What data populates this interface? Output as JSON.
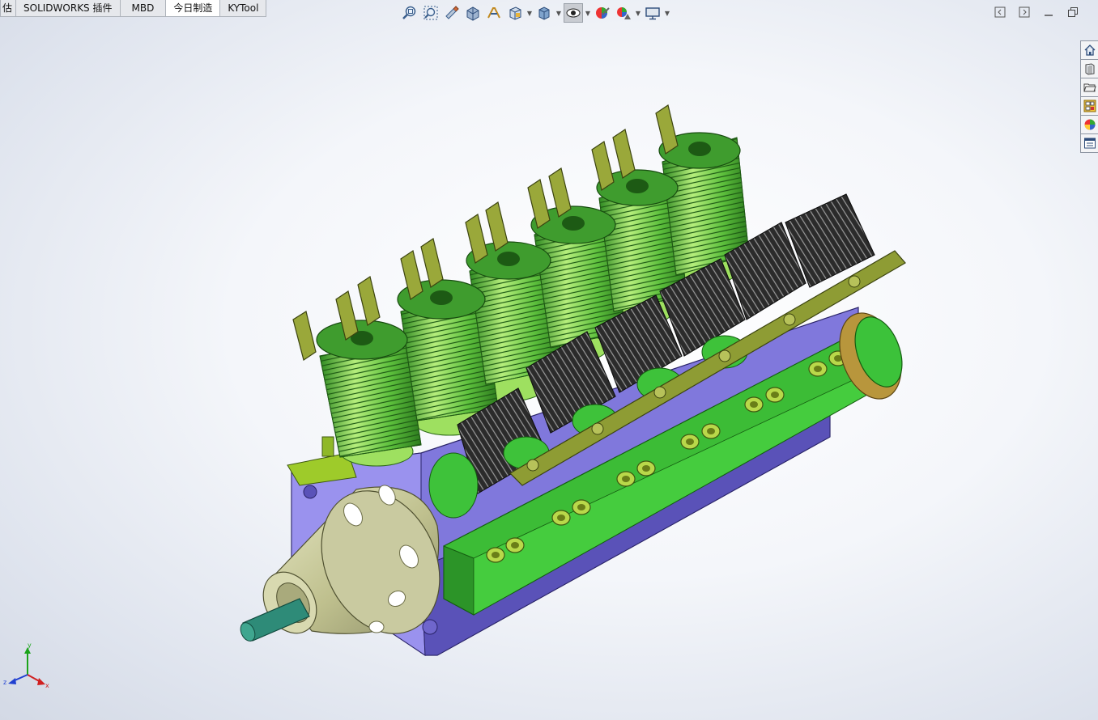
{
  "tabs": [
    {
      "label": "估",
      "active": false
    },
    {
      "label": "SOLIDWORKS 插件",
      "active": false
    },
    {
      "label": "MBD",
      "active": false
    },
    {
      "label": "今日制造",
      "active": true
    },
    {
      "label": "KYTool",
      "active": false
    }
  ],
  "toolbar": {
    "buttons": [
      "zoom-to-fit-icon",
      "zoom-to-area-icon",
      "previous-view-icon",
      "section-view-icon",
      "dynamic-annotation-icon",
      "view-orientation-icon",
      "display-style-icon",
      "hide-show-items-icon",
      "edit-appearance-icon",
      "apply-scene-icon",
      "view-settings-icon"
    ]
  },
  "window_controls": [
    "collapse-left-icon",
    "collapse-right-icon",
    "minimize-icon",
    "restore-icon"
  ],
  "task_pane": [
    "home-icon",
    "design-library-icon",
    "file-explorer-icon",
    "view-palette-icon",
    "appearances-icon",
    "custom-properties-icon"
  ],
  "triad": {
    "x": "x",
    "y": "y",
    "z": "z"
  },
  "colors": {
    "crankcase": "#8a82e0",
    "cylinder_green": "#4fb63a",
    "cylinder_light": "#a8e07a",
    "head_black": "#2a2a2a",
    "nose_cone": "#c8c9a0",
    "shaft": "#2e8b78",
    "bracket": "#7a8c2a",
    "flywheel": "#b8963c"
  }
}
